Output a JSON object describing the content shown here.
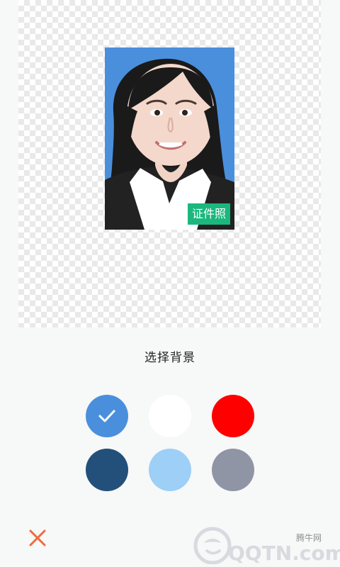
{
  "preview": {
    "badge_label": "证件照"
  },
  "background": {
    "title": "选择背景",
    "options": [
      {
        "color": "#4a8fdc",
        "selected": true
      },
      {
        "color": "#ffffff",
        "selected": false
      },
      {
        "color": "#ff0000",
        "selected": false
      },
      {
        "color": "#22507a",
        "selected": false
      },
      {
        "color": "#9dcff7",
        "selected": false
      },
      {
        "color": "#8f95a5",
        "selected": false
      }
    ]
  },
  "toolbar": {
    "cancel_icon": "close-icon",
    "cancel_color": "#f06c3d"
  },
  "watermark": {
    "brand": "QQTN",
    "suffix": ".com",
    "small_text": "腾牛网"
  }
}
